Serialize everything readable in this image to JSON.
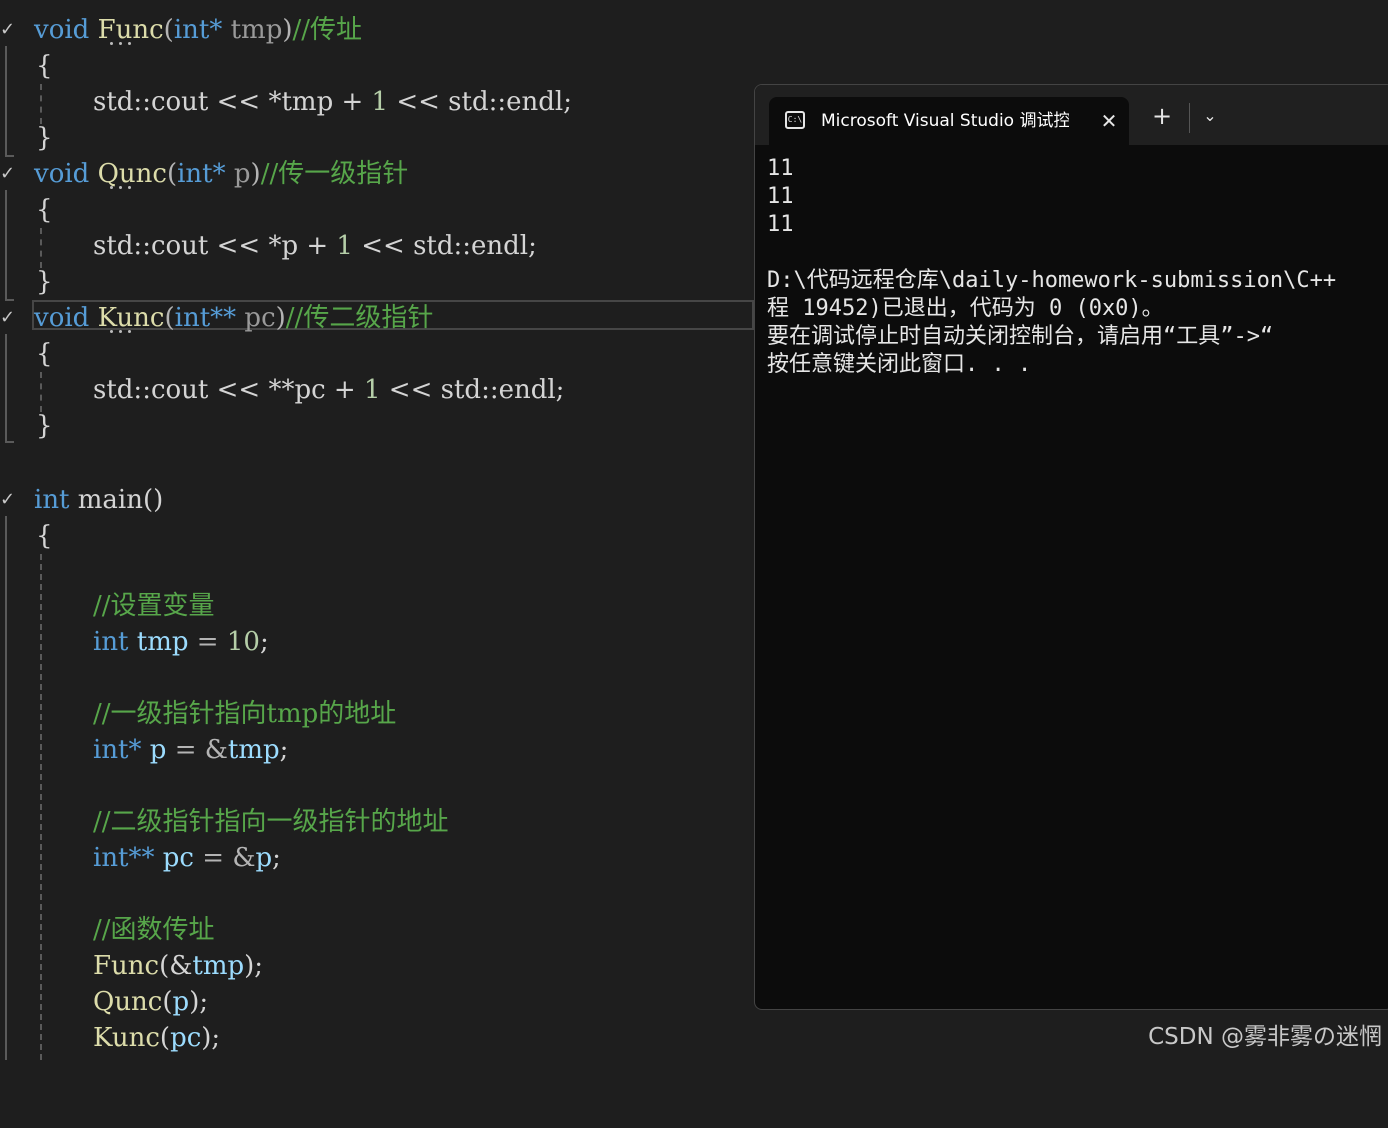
{
  "editor": {
    "lines": {
      "func_decl": {
        "kw": "void",
        "name": "Func",
        "open": "(",
        "type": "int*",
        "param": " tmp",
        "close": ")",
        "comment": "//传址"
      },
      "qunc_decl": {
        "kw": "void",
        "name": "Qunc",
        "open": "(",
        "type": "int*",
        "param": " p",
        "close": ")",
        "comment": "//传一级指针"
      },
      "kunc_decl": {
        "kw": "void",
        "name": "Kunc",
        "open": "(",
        "type": "int**",
        "param": " pc",
        "close": ")",
        "comment": "//传二级指针"
      },
      "open_brace": "{",
      "close_brace": "}",
      "func_body": {
        "a": "std::cout << *tmp + ",
        "num": "1",
        "b": " << std::endl;"
      },
      "qunc_body": {
        "a": "std::cout << *p + ",
        "num": "1",
        "b": " << std::endl;"
      },
      "kunc_body": {
        "a": "std::cout << **pc + ",
        "num": "1",
        "b": " << std::endl;"
      },
      "main_decl": {
        "kw": "int",
        "rest": " main()"
      },
      "comment_vars": "//设置变量",
      "int_tmp": {
        "kw": "int",
        "var": " tmp",
        "op": " = ",
        "num": "10",
        "end": ";"
      },
      "comment_p": "//一级指针指向tmp的地址",
      "int_p": {
        "kw": "int*",
        "var": " p",
        "op": " = &",
        "var2": "tmp",
        "end": ";"
      },
      "comment_pc": "//二级指针指向一级指针的地址",
      "int_pc": {
        "kw": "int**",
        "var": " pc",
        "op": " = &",
        "var2": "p",
        "end": ";"
      },
      "comment_call": "//函数传址",
      "call_func": {
        "fn": "Func",
        "open": "(&",
        "arg": "tmp",
        "close": ");"
      },
      "call_qunc": {
        "fn": "Qunc",
        "open": "(",
        "arg": "p",
        "close": ");"
      },
      "call_kunc": {
        "fn": "Kunc",
        "open": "(",
        "arg": "pc",
        "close": ");"
      }
    },
    "fold_glyph": "✓"
  },
  "terminal": {
    "tab_title": "Microsoft Visual Studio 调试控制台",
    "tab_icon_text": "C:\\",
    "close_glyph": "✕",
    "new_tab_glyph": "+",
    "dropdown_glyph": "⌄",
    "output": [
      "11",
      "11",
      "11",
      "",
      "D:\\代码远程仓库\\daily-homework-submission\\C++",
      "程 19452)已退出，代码为 0 (0x0)。",
      "要在调试停止时自动关闭控制台，请启用“工具”->“",
      "按任意键关闭此窗口. . ."
    ]
  },
  "watermark": "CSDN @雾非雾の迷惘"
}
